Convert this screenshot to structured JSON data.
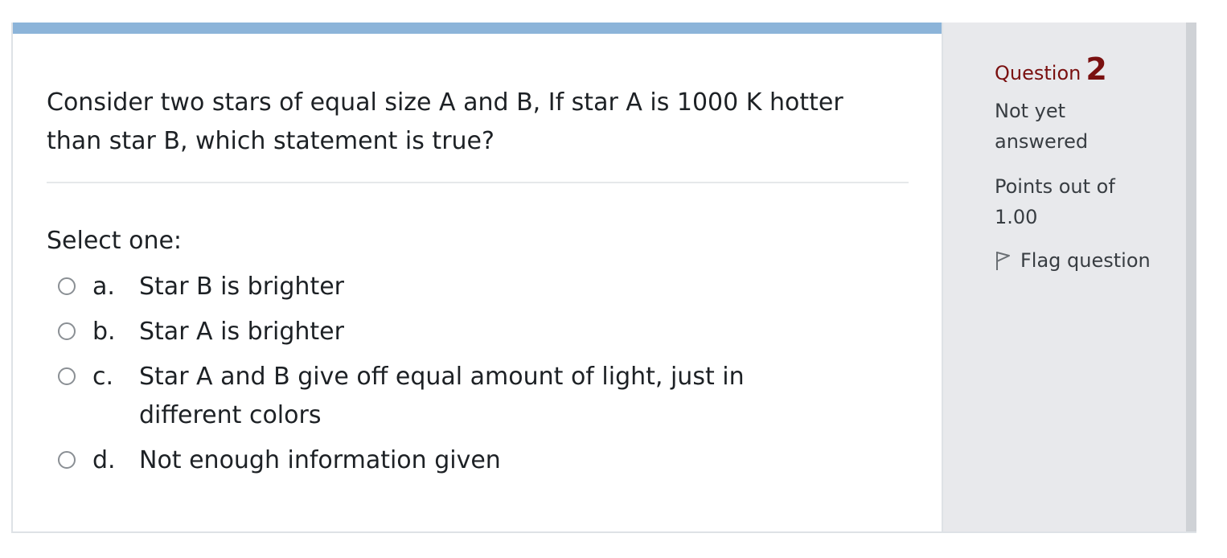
{
  "question": {
    "text": "Consider two stars of equal size A and B, If star A is 1000 K hotter than star B, which statement is true?",
    "prompt": "Select one:",
    "answers": [
      {
        "letter": "a.",
        "text": "Star B is brighter"
      },
      {
        "letter": "b.",
        "text": "Star A is brighter"
      },
      {
        "letter": "c.",
        "text": "Star A and B give off equal amount of light, just in different colors"
      },
      {
        "letter": "d.",
        "text": "Not enough information given"
      }
    ]
  },
  "info": {
    "question_label": "Question",
    "question_number": "2",
    "state": "Not yet answered",
    "grade": "Points out of 1.00",
    "flag_label": "Flag question",
    "flag_icon": "flag-outline-icon"
  },
  "colors": {
    "accent_bar": "#8cb4d9",
    "question_number": "#7a1010",
    "info_panel_bg": "#e8e9ec"
  }
}
